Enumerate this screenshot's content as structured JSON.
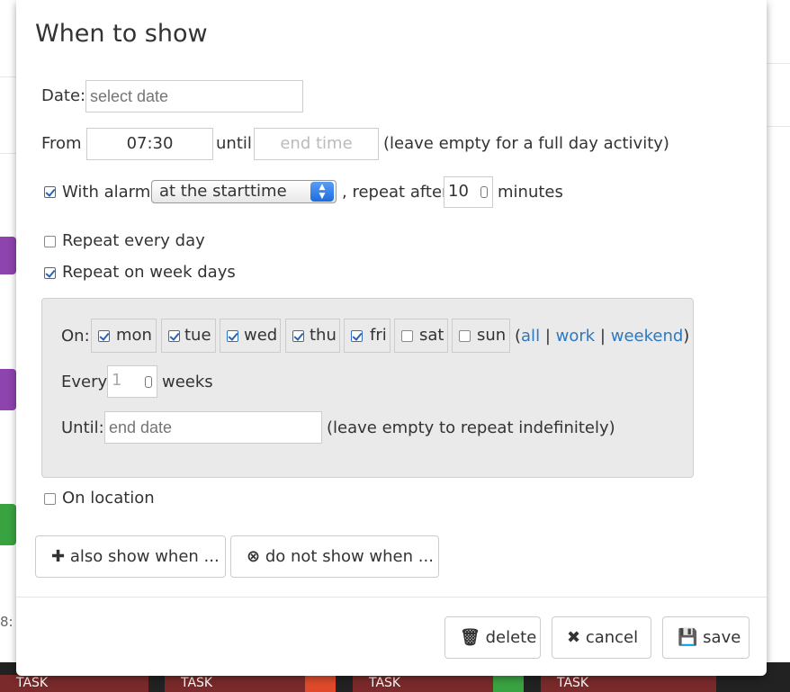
{
  "modal": {
    "title": "When to show"
  },
  "date": {
    "label": "Date:",
    "placeholder": "select date"
  },
  "time": {
    "from_label": "From",
    "from_value": "07:30",
    "until_label": "until",
    "end_placeholder": "end time",
    "hint": "(leave empty for a full day activity)"
  },
  "alarm": {
    "checked": true,
    "label": "With alarm",
    "selected_option": "at the starttime",
    "repeat_label": ", repeat after",
    "repeat_value": "10",
    "minutes_label": "minutes"
  },
  "repeat_every_day": {
    "checked": false,
    "label": "Repeat every day"
  },
  "repeat_week_days": {
    "checked": true,
    "label": "Repeat on week days"
  },
  "weekdays": {
    "on_label": "On:",
    "days": [
      {
        "label": "mon",
        "checked": true
      },
      {
        "label": "tue",
        "checked": true
      },
      {
        "label": "wed",
        "checked": true
      },
      {
        "label": "thu",
        "checked": true
      },
      {
        "label": "fri",
        "checked": true
      },
      {
        "label": "sat",
        "checked": false
      },
      {
        "label": "sun",
        "checked": false
      }
    ],
    "open_paren": "(",
    "all_link": "all",
    "sep1": "|",
    "work_link": "work",
    "sep2": "|",
    "weekend_link": "weekend",
    "close_paren": ")",
    "every_label": "Every",
    "every_value": "1",
    "weeks_label": "weeks",
    "until_label": "Until:",
    "until_placeholder": "end date",
    "until_hint": "(leave empty to repeat indefinitely)"
  },
  "on_location": {
    "checked": false,
    "label": "On location"
  },
  "buttons": {
    "also_show": "also show when ...",
    "do_not_show": "do not show when ...",
    "delete": "delete",
    "cancel": "cancel",
    "save": "save"
  },
  "background": {
    "task_label": "TASK",
    "time_fragment": "8:"
  },
  "colors": {
    "link": "#2b79c2",
    "checkbox_checked": "#2a63b3",
    "task_bar": "#7a2a2a",
    "badge_green": "#3aa341",
    "badge_red": "#e04a2b",
    "purple_tab": "#8e44ad",
    "green_tab": "#3aa341"
  }
}
